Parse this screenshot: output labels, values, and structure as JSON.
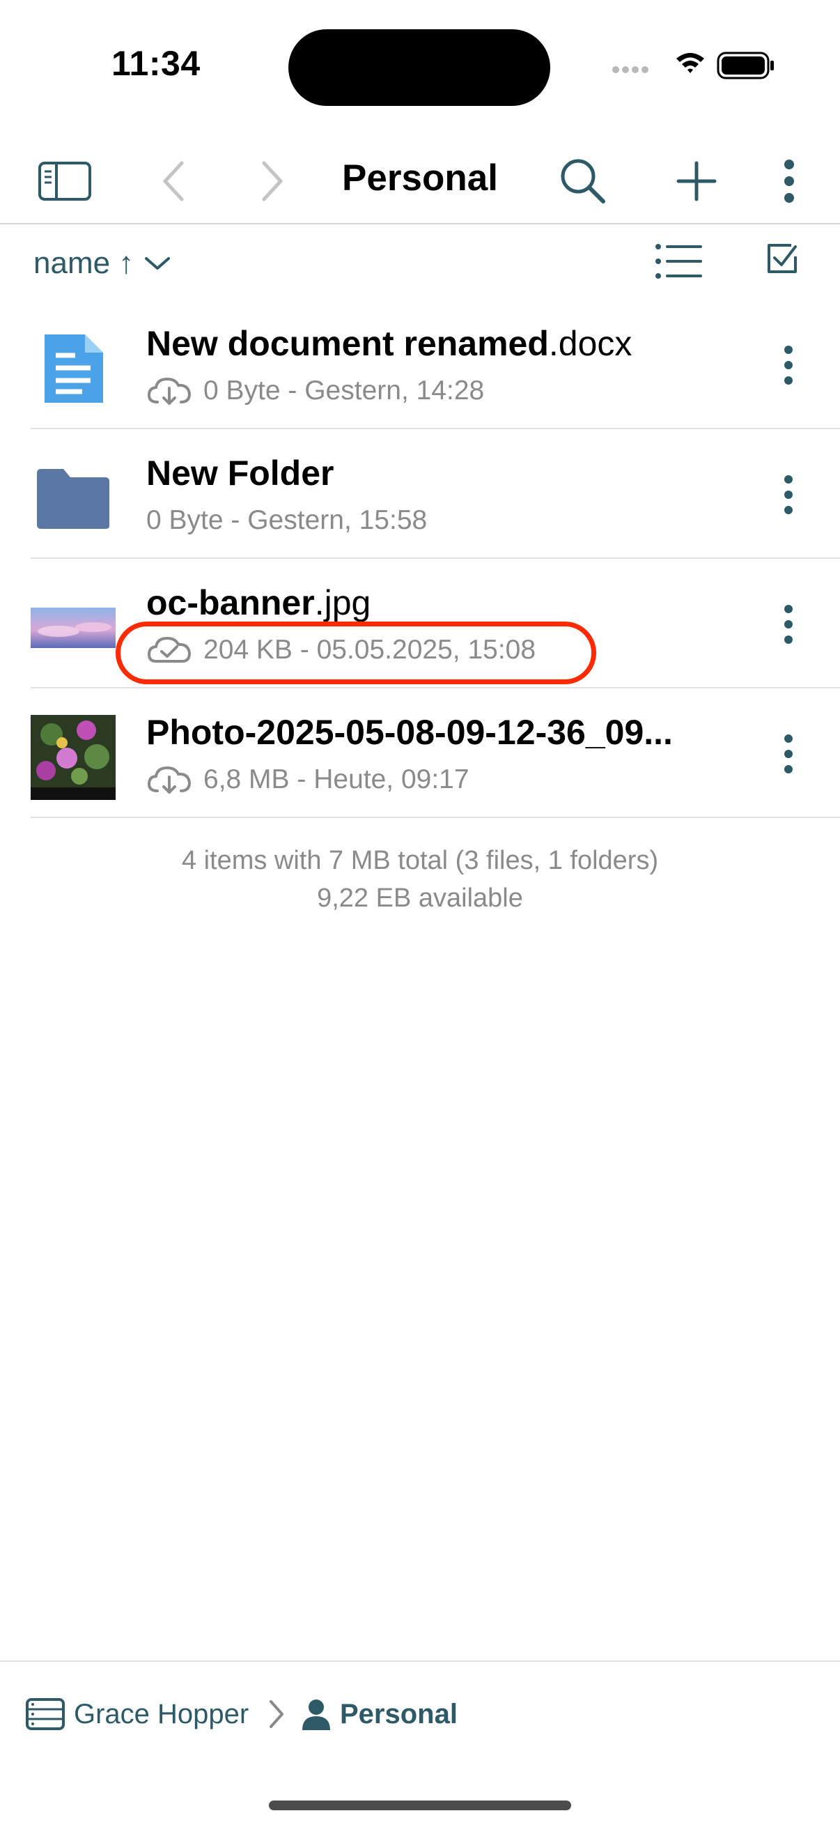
{
  "status_bar": {
    "time": "11:34"
  },
  "nav": {
    "title": "Personal",
    "icons": [
      "sidebar-icon",
      "back-chevron-icon",
      "forward-chevron-icon",
      "search-icon",
      "plus-icon",
      "more-vertical-icon"
    ]
  },
  "sort": {
    "label": "name ↑"
  },
  "files": [
    {
      "base": "New document renamed",
      "ext": ".docx",
      "meta": "0 Byte - Gestern, 14:28",
      "cloud": "cloud-download-icon",
      "type": "document"
    },
    {
      "base": "New Folder",
      "ext": "",
      "meta": "0 Byte - Gestern, 15:58",
      "cloud": "",
      "type": "folder"
    },
    {
      "base": "oc-banner",
      "ext": ".jpg",
      "meta": "204 KB - 05.05.2025, 15:08",
      "cloud": "cloud-check-icon",
      "type": "image"
    },
    {
      "base": "Photo-2025-05-08-09-12-36_09...",
      "ext": "",
      "meta": "6,8 MB - Heute, 09:17",
      "cloud": "cloud-download-icon",
      "type": "photo"
    }
  ],
  "summary": {
    "line1": "4 items with 7 MB total (3 files, 1 folders)",
    "line2": "9,22 EB available"
  },
  "breadcrumb": {
    "root": "Grace Hopper",
    "current": "Personal"
  },
  "colors": {
    "accent": "#2e5a68",
    "highlight": "#ff2a00",
    "doc_blue": "#4aa3e8",
    "folder": "#5b77a3"
  }
}
